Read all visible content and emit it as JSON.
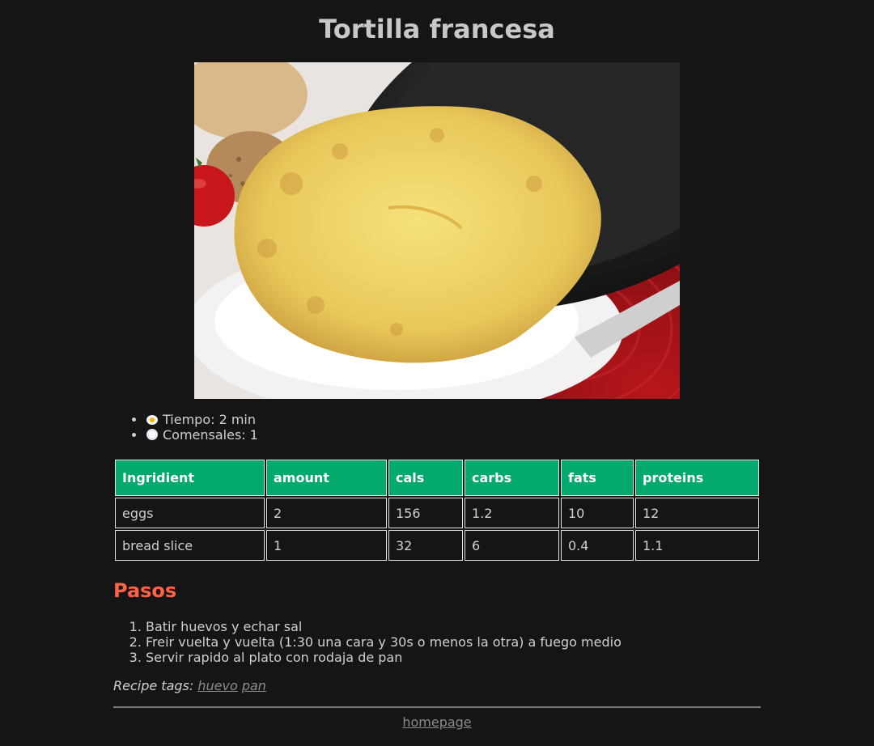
{
  "page": {
    "title": "Tortilla francesa"
  },
  "info": {
    "time": "Tiempo: 2 min",
    "servings": "Comensales: 1",
    "time_icon": "fried-egg-icon",
    "servings_icon": "plate-icon"
  },
  "table": {
    "headers": [
      "Ingridient",
      "amount",
      "cals",
      "carbs",
      "fats",
      "proteins"
    ],
    "rows": [
      [
        "eggs",
        "2",
        "156",
        "1.2",
        "10",
        "12"
      ],
      [
        "bread slice",
        "1",
        "32",
        "6",
        "0.4",
        "1.1"
      ]
    ]
  },
  "steps": {
    "heading": "Pasos",
    "items": [
      "Batir huevos y echar sal",
      "Freir vuelta y vuelta (1:30 una cara y 30s o menos la otra) a fuego medio",
      "Servir rapido al plato con rodaja de pan"
    ]
  },
  "tags": {
    "label": "Recipe tags:",
    "items": [
      "huevo",
      "pan"
    ]
  },
  "footer": {
    "link": "homepage"
  },
  "colors": {
    "background": "#151515",
    "table_header": "#04aa6d",
    "heading_accent": "#ff6347"
  }
}
